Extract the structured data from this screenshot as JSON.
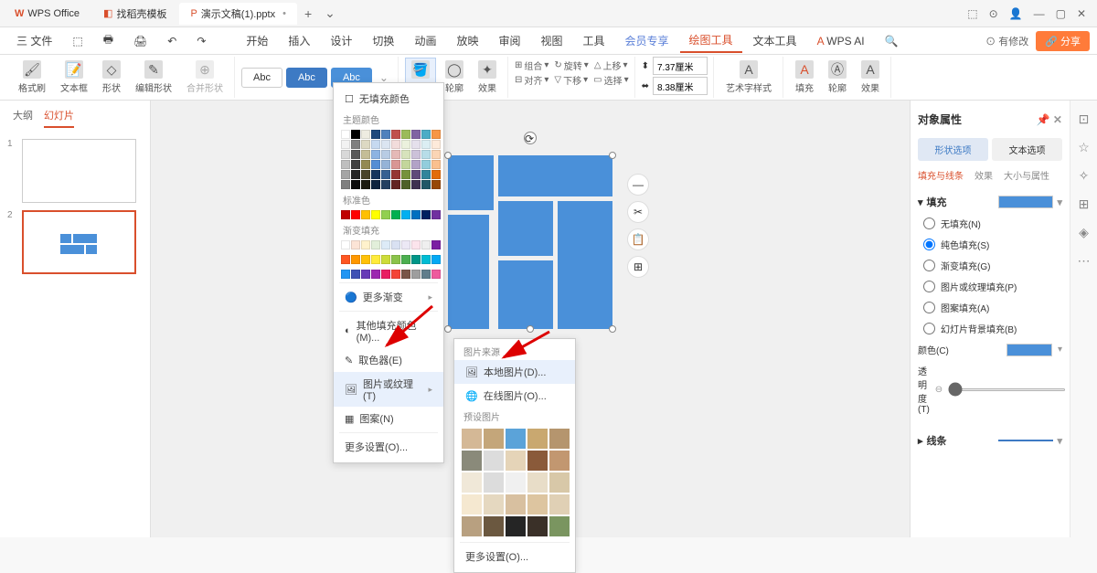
{
  "title_bar": {
    "app_name": "WPS Office",
    "tab1": "找稻壳模板",
    "tab2": "演示文稿(1).pptx",
    "new_tab": "+"
  },
  "window_controls": [
    "⬚",
    "⊙",
    "👤",
    "—",
    "▢",
    "✕"
  ],
  "menu": {
    "file": "三 文件",
    "quick_icons": [
      "⬚",
      "🖶",
      "🖨",
      "↶",
      "↷"
    ],
    "tabs": [
      "开始",
      "插入",
      "设计",
      "切换",
      "动画",
      "放映",
      "审阅",
      "视图",
      "工具",
      "会员专享",
      "绘图工具",
      "文本工具"
    ],
    "wps_ai": "WPS AI",
    "changes": "⊙ 有修改",
    "share": "🔗 分享"
  },
  "ribbon": {
    "g1": {
      "b1": "格式刷",
      "b2": "文本框",
      "b3": "形状",
      "b4": "编辑形状",
      "b5": "合并形状"
    },
    "abc": "Abc",
    "g3": {
      "fill": "填充",
      "outline": "轮廓",
      "effect": "效果"
    },
    "g4": {
      "group": "组合",
      "align": "对齐",
      "rotate": "旋转",
      "up": "上移",
      "down": "下移",
      "select": "选择"
    },
    "g5": {
      "w": "7.37厘米",
      "h": "8.38厘米"
    },
    "g6": {
      "art": "艺术字样式"
    },
    "g7": {
      "fill": "填充",
      "outline": "轮廓",
      "effect": "效果"
    }
  },
  "slide_panel": {
    "tab1": "大纲",
    "tab2": "幻灯片"
  },
  "dropdown1": {
    "no_fill": "无填充颜色",
    "theme_colors": "主题颜色",
    "standard_colors": "标准色",
    "gradient": "渐变填充",
    "more_gradient": "更多渐变",
    "other_colors": "其他填充颜色(M)...",
    "eyedropper": "取色器(E)",
    "picture_texture": "图片或纹理(T)",
    "pattern": "图案(N)",
    "more_settings": "更多设置(O)..."
  },
  "dropdown2": {
    "source": "图片来源",
    "local": "本地图片(D)...",
    "online": "在线图片(O)...",
    "preset": "预设图片",
    "more": "更多设置(O)..."
  },
  "prop_panel": {
    "title": "对象属性",
    "tab_shape": "形状选项",
    "tab_text": "文本选项",
    "sub1": "填充与线条",
    "sub2": "效果",
    "sub3": "大小与属性",
    "fill_section": "填充",
    "no_fill": "无填充(N)",
    "solid_fill": "纯色填充(S)",
    "gradient_fill": "渐变填充(G)",
    "pic_fill": "图片或纹理填充(P)",
    "pattern_fill": "图案填充(A)",
    "slide_bg_fill": "幻灯片背景填充(B)",
    "color": "颜色(C)",
    "opacity": "透明度(T)",
    "opacity_val": "0",
    "opacity_unit": "%",
    "line_section": "线条"
  },
  "theme_colors_grid": [
    "#ffffff",
    "#000000",
    "#eeece1",
    "#1f497d",
    "#4f81bd",
    "#c0504d",
    "#9bbb59",
    "#8064a2",
    "#4bacc6",
    "#f79646",
    "#f2f2f2",
    "#7f7f7f",
    "#ddd9c3",
    "#c6d9f0",
    "#dbe5f1",
    "#f2dcdb",
    "#ebf1dd",
    "#e5e0ec",
    "#dbeef3",
    "#fdeada",
    "#d8d8d8",
    "#595959",
    "#c4bd97",
    "#8db3e2",
    "#b8cce4",
    "#e5b9b7",
    "#d7e3bc",
    "#ccc1d9",
    "#b7dde8",
    "#fbd5b5",
    "#bfbfbf",
    "#3f3f3f",
    "#938953",
    "#548dd4",
    "#95b3d7",
    "#d99694",
    "#c3d69b",
    "#b2a2c7",
    "#92cddc",
    "#fac08f",
    "#a5a5a5",
    "#262626",
    "#494429",
    "#17365d",
    "#366092",
    "#953734",
    "#76923c",
    "#5f497a",
    "#31859b",
    "#e36c09",
    "#7f7f7f",
    "#0c0c0c",
    "#1d1b10",
    "#0f243e",
    "#244061",
    "#632423",
    "#4f6128",
    "#3f3151",
    "#205867",
    "#974806"
  ],
  "standard_colors": [
    "#c00000",
    "#ff0000",
    "#ffc000",
    "#ffff00",
    "#92d050",
    "#00b050",
    "#00b0f0",
    "#0070c0",
    "#002060",
    "#7030a0"
  ],
  "gradient_colors1": [
    "#fff",
    "#fce4d6",
    "#fff2cc",
    "#e2efda",
    "#ddebf7",
    "#d9e1f2",
    "#ece8f5",
    "#fce4ec",
    "#efefef",
    "#7b1fa2"
  ],
  "gradient_colors2": [
    "#ff5722",
    "#ff9800",
    "#ffc107",
    "#ffeb3b",
    "#cddc39",
    "#8bc34a",
    "#4caf50",
    "#009688",
    "#00bcd4",
    "#03a9f4"
  ],
  "gradient_colors3": [
    "#2196f3",
    "#3f51b5",
    "#673ab7",
    "#9c27b0",
    "#e91e63",
    "#f44336",
    "#795548",
    "#9e9e9e",
    "#607d8b",
    "#ee5a9d"
  ],
  "textures": [
    "#d4b896",
    "#c4a67a",
    "#5ba3d9",
    "#c9a870",
    "#b5956e",
    "#8a8a7a",
    "#dcdcdc",
    "#e5d4b8",
    "#8a5a3a",
    "#c29770",
    "#f0e8d8",
    "#dcdcdc",
    "#f0f0f0",
    "#e8ddc8",
    "#d8c8a8",
    "#f5e8d0",
    "#e5d8c0",
    "#d8c0a0",
    "#ddc5a0",
    "#e0d0b5",
    "#b8a080",
    "#6b5840",
    "#252525",
    "#3a3028",
    "#7a9560"
  ]
}
